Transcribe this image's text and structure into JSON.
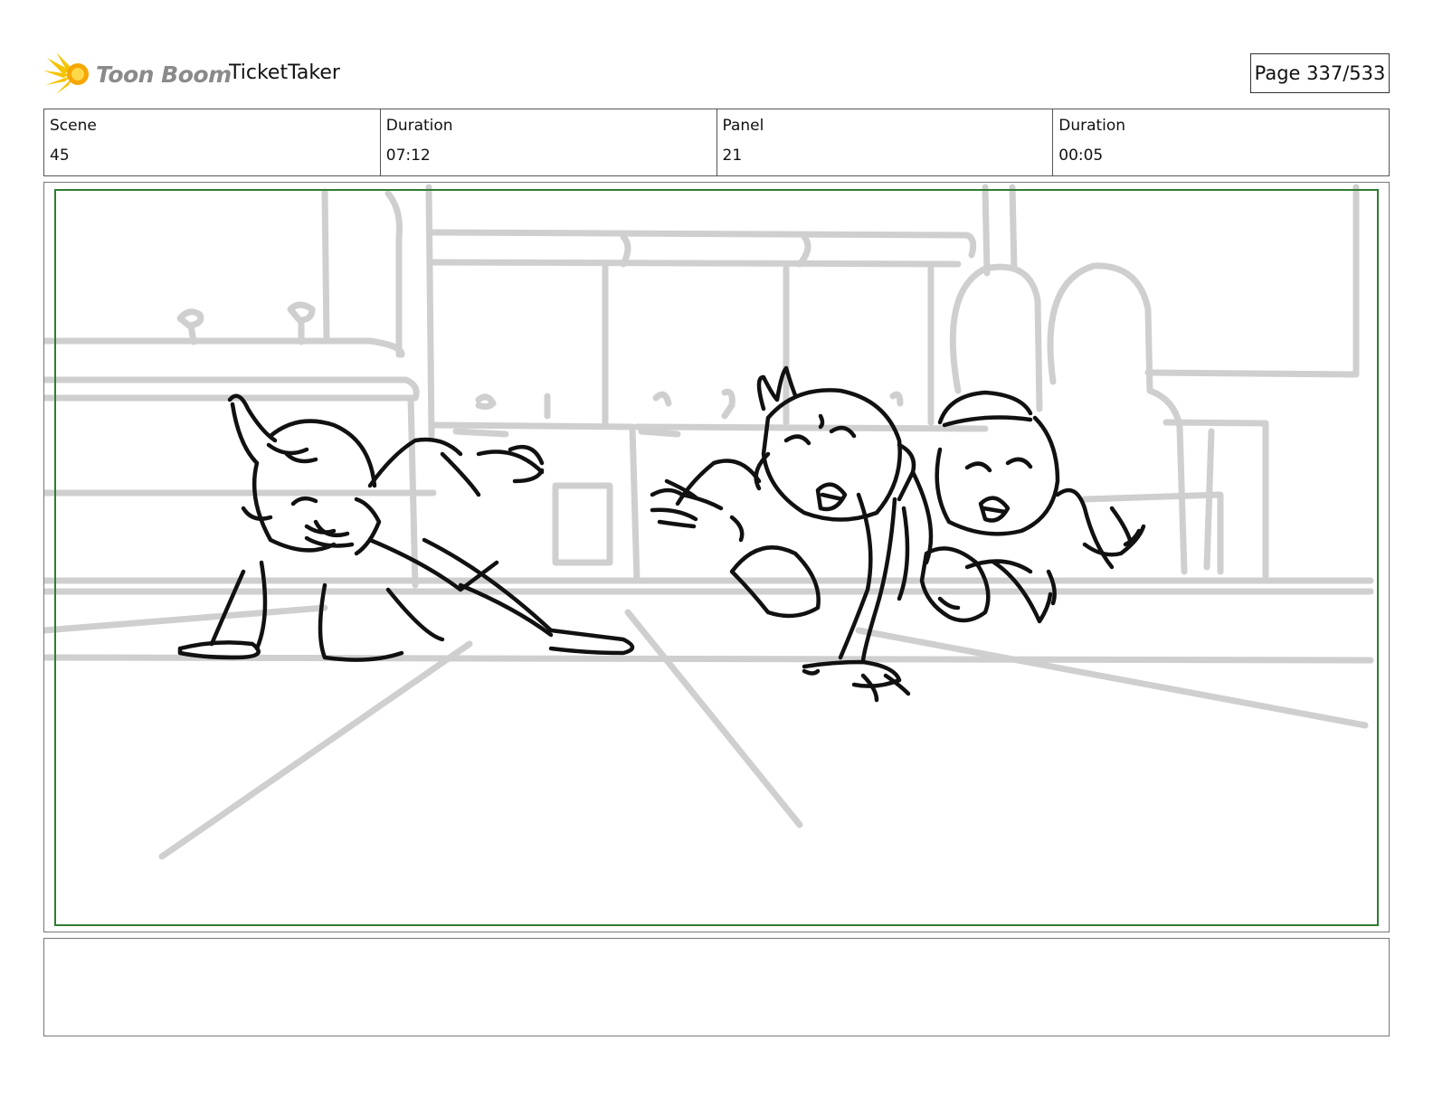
{
  "header": {
    "logo_text": "Toon Boom",
    "project_title": "TicketTaker",
    "page_indicator": "Page 337/533"
  },
  "info": {
    "scene_label": "Scene",
    "scene_value": "45",
    "scene_duration_label": "Duration",
    "scene_duration_value": "07:12",
    "panel_label": "Panel",
    "panel_value": "21",
    "panel_duration_label": "Duration",
    "panel_duration_value": "00:05"
  },
  "panel": {
    "frame_color": "#2e7d32",
    "sketch_background_color": "#cfcfcf",
    "sketch_line_color": "#111111"
  },
  "notes": {
    "text": ""
  }
}
